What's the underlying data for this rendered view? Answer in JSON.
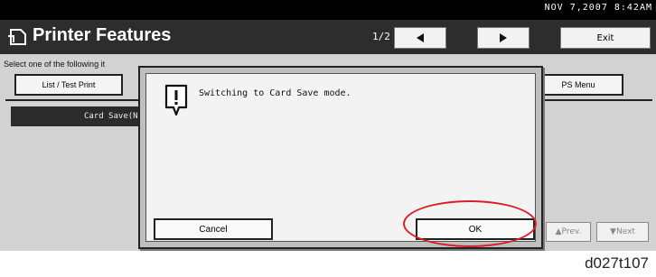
{
  "status": {
    "date_time": "NOV   7,2007  8:42AM"
  },
  "header": {
    "title": "Printer Features",
    "page_indicator": "1/2",
    "exit_label": "Exit"
  },
  "main": {
    "instruction": "Select one of the following it",
    "tabs": [
      {
        "label": "List / Test Print"
      },
      {
        "label": "PS Menu"
      }
    ],
    "list_item": "Card Save(Ne",
    "nav_buttons": [
      {
        "label": "▲Prev."
      },
      {
        "label": "▼Next"
      }
    ]
  },
  "dialog": {
    "message": "Switching to Card Save mode.",
    "cancel_label": "Cancel",
    "ok_label": "OK"
  },
  "caption": "d027t107",
  "colors": {
    "highlight": "#d8202a",
    "titlebar": "#2d2d2d"
  }
}
